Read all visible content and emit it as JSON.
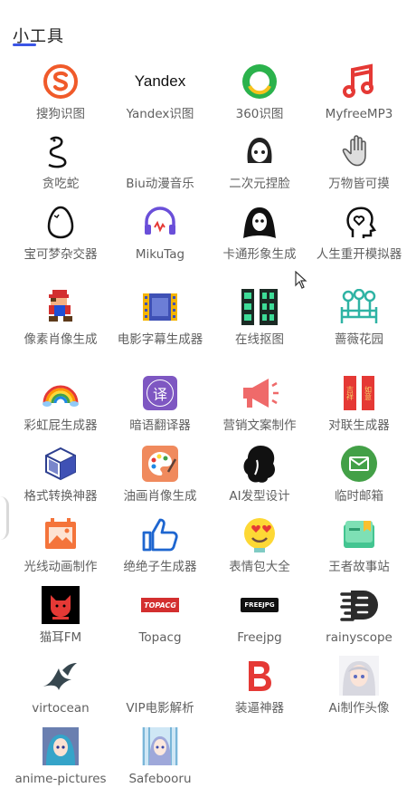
{
  "header": {
    "title": "小工具"
  },
  "tools": [
    {
      "label": "搜狗识图",
      "icon": "sogou-icon"
    },
    {
      "label": "Yandex识图",
      "icon": "yandex-icon"
    },
    {
      "label": "360识图",
      "icon": "360-icon"
    },
    {
      "label": "MyfreeMP3",
      "icon": "music-note-icon"
    },
    {
      "label": "贪吃蛇",
      "icon": "snake-icon"
    },
    {
      "label": "Biu动漫音乐",
      "icon": "biu-icon"
    },
    {
      "label": "二次元捏脸",
      "icon": "anime-face-icon"
    },
    {
      "label": "万物皆可摸",
      "icon": "hand-icon"
    },
    {
      "label": "宝可梦杂交器",
      "icon": "egg-icon"
    },
    {
      "label": "MikuTag",
      "icon": "headphones-icon"
    },
    {
      "label": "卡通形象生成",
      "icon": "cartoon-ghost-icon"
    },
    {
      "label": "人生重开模拟器",
      "icon": "head-heart-icon"
    },
    {
      "label": "像素肖像生成",
      "icon": "pixel-mario-icon"
    },
    {
      "label": "电影字幕生成器",
      "icon": "film-icon"
    },
    {
      "label": "在线抠图",
      "icon": "film-strips-icon"
    },
    {
      "label": "蔷薇花园",
      "icon": "garden-icon"
    },
    {
      "label": "彩虹屁生成器",
      "icon": "rainbow-icon"
    },
    {
      "label": "暗语翻译器",
      "icon": "translate-icon"
    },
    {
      "label": "营销文案制作",
      "icon": "megaphone-icon"
    },
    {
      "label": "对联生成器",
      "icon": "couplet-icon"
    },
    {
      "label": "格式转换神器",
      "icon": "cube-icon"
    },
    {
      "label": "油画肖像生成",
      "icon": "palette-icon"
    },
    {
      "label": "AI发型设计",
      "icon": "hair-icon"
    },
    {
      "label": "临时邮箱",
      "icon": "mail-icon"
    },
    {
      "label": "光线动画制作",
      "icon": "image-frame-icon"
    },
    {
      "label": "绝绝子生成器",
      "icon": "thumbs-up-icon"
    },
    {
      "label": "表情包大全",
      "icon": "emoji-icon"
    },
    {
      "label": "王者故事站",
      "icon": "book-icon"
    },
    {
      "label": "猫耳FM",
      "icon": "cat-fm-icon"
    },
    {
      "label": "Topacg",
      "icon": "topacg-icon"
    },
    {
      "label": "Freejpg",
      "icon": "freejpg-icon"
    },
    {
      "label": "rainyscope",
      "icon": "rainyscope-icon"
    },
    {
      "label": "virtocean",
      "icon": "birds-icon"
    },
    {
      "label": "VIP电影解析",
      "icon": "blank-icon"
    },
    {
      "label": "装逼神器",
      "icon": "letter-b-icon"
    },
    {
      "label": "Ai制作头像",
      "icon": "anime-avatar-icon"
    },
    {
      "label": "anime-pictures",
      "icon": "anime-pictures-icon"
    },
    {
      "label": "Safebooru",
      "icon": "safebooru-icon"
    }
  ],
  "logos": {
    "yandex": "Yandex",
    "topacg": "TOPACG",
    "freejpg": "FREEJPG",
    "translate_char": "译",
    "couplet_left": "吉祥",
    "couplet_right": "如意"
  },
  "colors": {
    "accent": "#3b55e6",
    "sogou": "#f05a2a",
    "green360": "#2bb24c",
    "red": "#e53935",
    "purple": "#6a4fd9",
    "teal": "#2fb3a4"
  }
}
